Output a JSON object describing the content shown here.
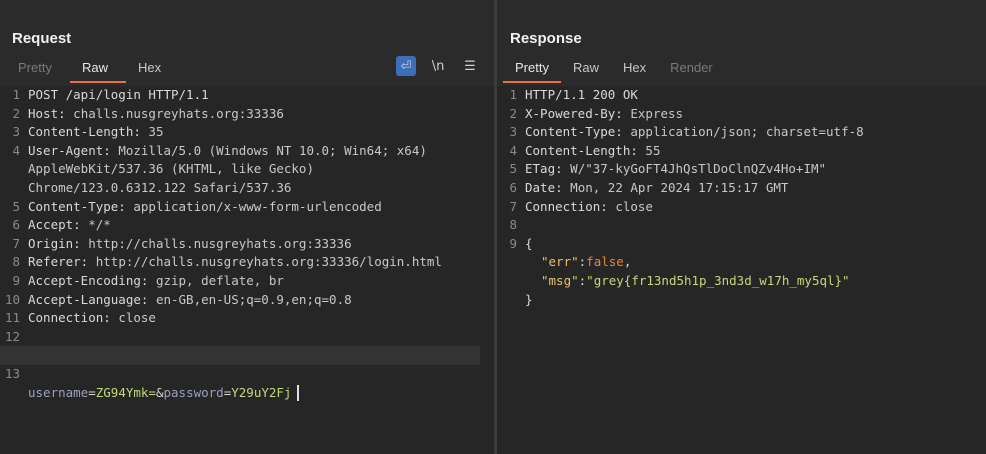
{
  "request": {
    "title": "Request",
    "tabs": [
      "Pretty",
      "Raw",
      "Hex"
    ],
    "tools": {
      "wrap": "⏎",
      "newline": "\\n",
      "menu": "☰"
    },
    "lines": [
      {
        "n": "1",
        "k": "POST /api/login HTTP/1.1",
        "v": ""
      },
      {
        "n": "2",
        "k": "Host:",
        "v": " challs.nusgreyhats.org:33336"
      },
      {
        "n": "3",
        "k": "Content-Length:",
        "v": " 35"
      },
      {
        "n": "4",
        "k": "User-Agent:",
        "v": " Mozilla/5.0 (Windows NT 10.0; Win64; x64)"
      },
      {
        "n": "",
        "k": "",
        "v": "AppleWebKit/537.36 (KHTML, like Gecko)"
      },
      {
        "n": "",
        "k": "",
        "v": "Chrome/123.0.6312.122 Safari/537.36"
      },
      {
        "n": "5",
        "k": "Content-Type:",
        "v": " application/x-www-form-urlencoded"
      },
      {
        "n": "6",
        "k": "Accept:",
        "v": " */*"
      },
      {
        "n": "7",
        "k": "Origin:",
        "v": " http://challs.nusgreyhats.org:33336"
      },
      {
        "n": "8",
        "k": "Referer:",
        "v": " http://challs.nusgreyhats.org:33336/login.html"
      },
      {
        "n": "9",
        "k": "Accept-Encoding:",
        "v": " gzip, deflate, br"
      },
      {
        "n": "10",
        "k": "Accept-Language:",
        "v": " en-GB,en-US;q=0.9,en;q=0.8"
      },
      {
        "n": "11",
        "k": "Connection:",
        "v": " close"
      },
      {
        "n": "12",
        "k": "",
        "v": ""
      }
    ],
    "body": {
      "n": "13",
      "k1": "username",
      "eq1": "=",
      "v1": "ZG94Ymk=",
      "amp": "&",
      "k2": "password",
      "eq2": "=",
      "v2": "Y29uY2Fj"
    }
  },
  "response": {
    "title": "Response",
    "tabs": [
      "Pretty",
      "Raw",
      "Hex",
      "Render"
    ],
    "lines": [
      {
        "n": "1",
        "k": "HTTP/1.1 200 OK",
        "v": ""
      },
      {
        "n": "2",
        "k": "X-Powered-By:",
        "v": " Express"
      },
      {
        "n": "3",
        "k": "Content-Type:",
        "v": " application/json; charset=utf-8"
      },
      {
        "n": "4",
        "k": "Content-Length:",
        "v": " 55"
      },
      {
        "n": "5",
        "k": "ETag:",
        "v": " W/\"37-kyGoFT4JhQsTlDoClnQZv4Ho+IM\""
      },
      {
        "n": "6",
        "k": "Date:",
        "v": " Mon, 22 Apr 2024 17:15:17 GMT"
      },
      {
        "n": "7",
        "k": "Connection:",
        "v": " close"
      },
      {
        "n": "8",
        "k": "",
        "v": ""
      }
    ],
    "json": {
      "n": "9",
      "open": "{",
      "err_key": "\"err\"",
      "err_colon": ":",
      "err_val": "false",
      "err_comma": ",",
      "msg_key": "\"msg\"",
      "msg_colon": ":",
      "msg_val": "\"grey{fr13nd5h1p_3nd3d_w17h_my5ql}\"",
      "close": "}"
    }
  }
}
